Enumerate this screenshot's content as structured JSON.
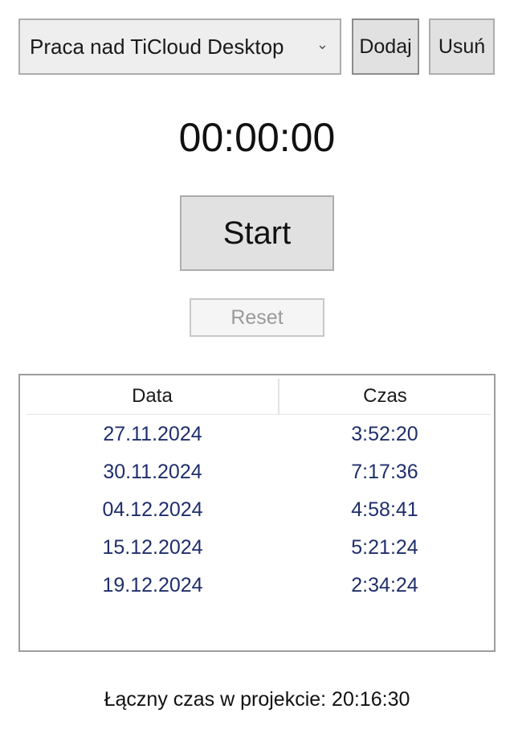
{
  "project_select": {
    "value": "Praca nad TiCloud Desktop"
  },
  "buttons": {
    "add_label": "Dodaj",
    "remove_label": "Usuń",
    "start_label": "Start",
    "reset_label": "Reset"
  },
  "timer": {
    "display": "00:00:00"
  },
  "log_table": {
    "columns": [
      "Data",
      "Czas"
    ],
    "rows": [
      {
        "date": "27.11.2024",
        "time": "3:52:20"
      },
      {
        "date": "30.11.2024",
        "time": "7:17:36"
      },
      {
        "date": "04.12.2024",
        "time": "4:58:41"
      },
      {
        "date": "15.12.2024",
        "time": "5:21:24"
      },
      {
        "date": "19.12.2024",
        "time": "2:34:24"
      }
    ]
  },
  "total": {
    "text": "Łączny czas w projekcie: 20:16:30"
  },
  "icons": {
    "dropdown": "chevron-down-icon"
  }
}
